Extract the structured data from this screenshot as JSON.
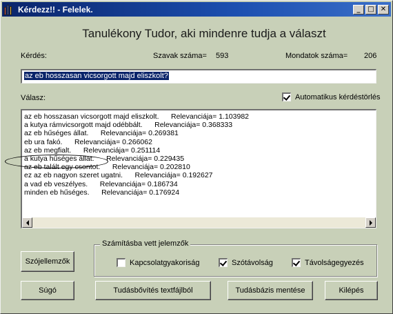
{
  "window": {
    "title": "Kérdezz!! - Felelek.",
    "controls": {
      "minimize": "_",
      "maximize": "□",
      "close": "✕"
    }
  },
  "heading": "Tanulékony Tudor, aki mindenre tudja a választ",
  "question_label": "Kérdés:",
  "word_count": {
    "label": "Szavak száma=",
    "value": "593"
  },
  "sentence_count": {
    "label": "Mondatok száma=",
    "value": "206"
  },
  "question_value": "az eb hosszasan vicsorgott majd eliszkolt?",
  "answer_label": "Válasz:",
  "auto_delete": {
    "label": "Automatikus kérdéstörlés",
    "checked": true
  },
  "answers": [
    {
      "text": "az eb hosszasan vicsorgott majd eliszkolt.",
      "rel": "Relevanciája= 1.103982"
    },
    {
      "text": "a kutya rámvicsorgott majd odébbált.",
      "rel": "Relevanciája= 0.368333"
    },
    {
      "text": "az eb hűséges állat.",
      "rel": "Relevanciája= 0.269381"
    },
    {
      "text": "eb ura fakó.",
      "rel": "Relevanciája= 0.266062"
    },
    {
      "text": "az eb megfialt.",
      "rel": "Relevanciája= 0.251114"
    },
    {
      "text": "a kutya hűséges állat.",
      "rel": "Relevanciája= 0.229435"
    },
    {
      "text": "az eb talált egy csontot.",
      "rel": "Relevanciája= 0.202810"
    },
    {
      "text": "ez az eb nagyon szeret ugatni.",
      "rel": "Relevanciája= 0.192627"
    },
    {
      "text": "a vad eb veszélyes.",
      "rel": "Relevanciája= 0.186734"
    },
    {
      "text": "minden eb hűséges.",
      "rel": "Relevanciája= 0.176924"
    }
  ],
  "features_group": {
    "title": "Számításba vett jelemzők",
    "options": [
      {
        "label": "Kapcsolatgyakoriság",
        "checked": false
      },
      {
        "label": "Szótávolság",
        "checked": true
      },
      {
        "label": "Távolságegyezés",
        "checked": true
      }
    ]
  },
  "buttons": {
    "word_features": "Szójellemzők",
    "help": "Súgó",
    "extend_kb": "Tudásbővítés textfájlból",
    "save_kb": "Tudásbázis mentése",
    "exit": "Kilépés"
  },
  "colors": {
    "window_bg": "#c8d0b8",
    "titlebar": "#1c3f94",
    "selection": "#0a246a"
  }
}
